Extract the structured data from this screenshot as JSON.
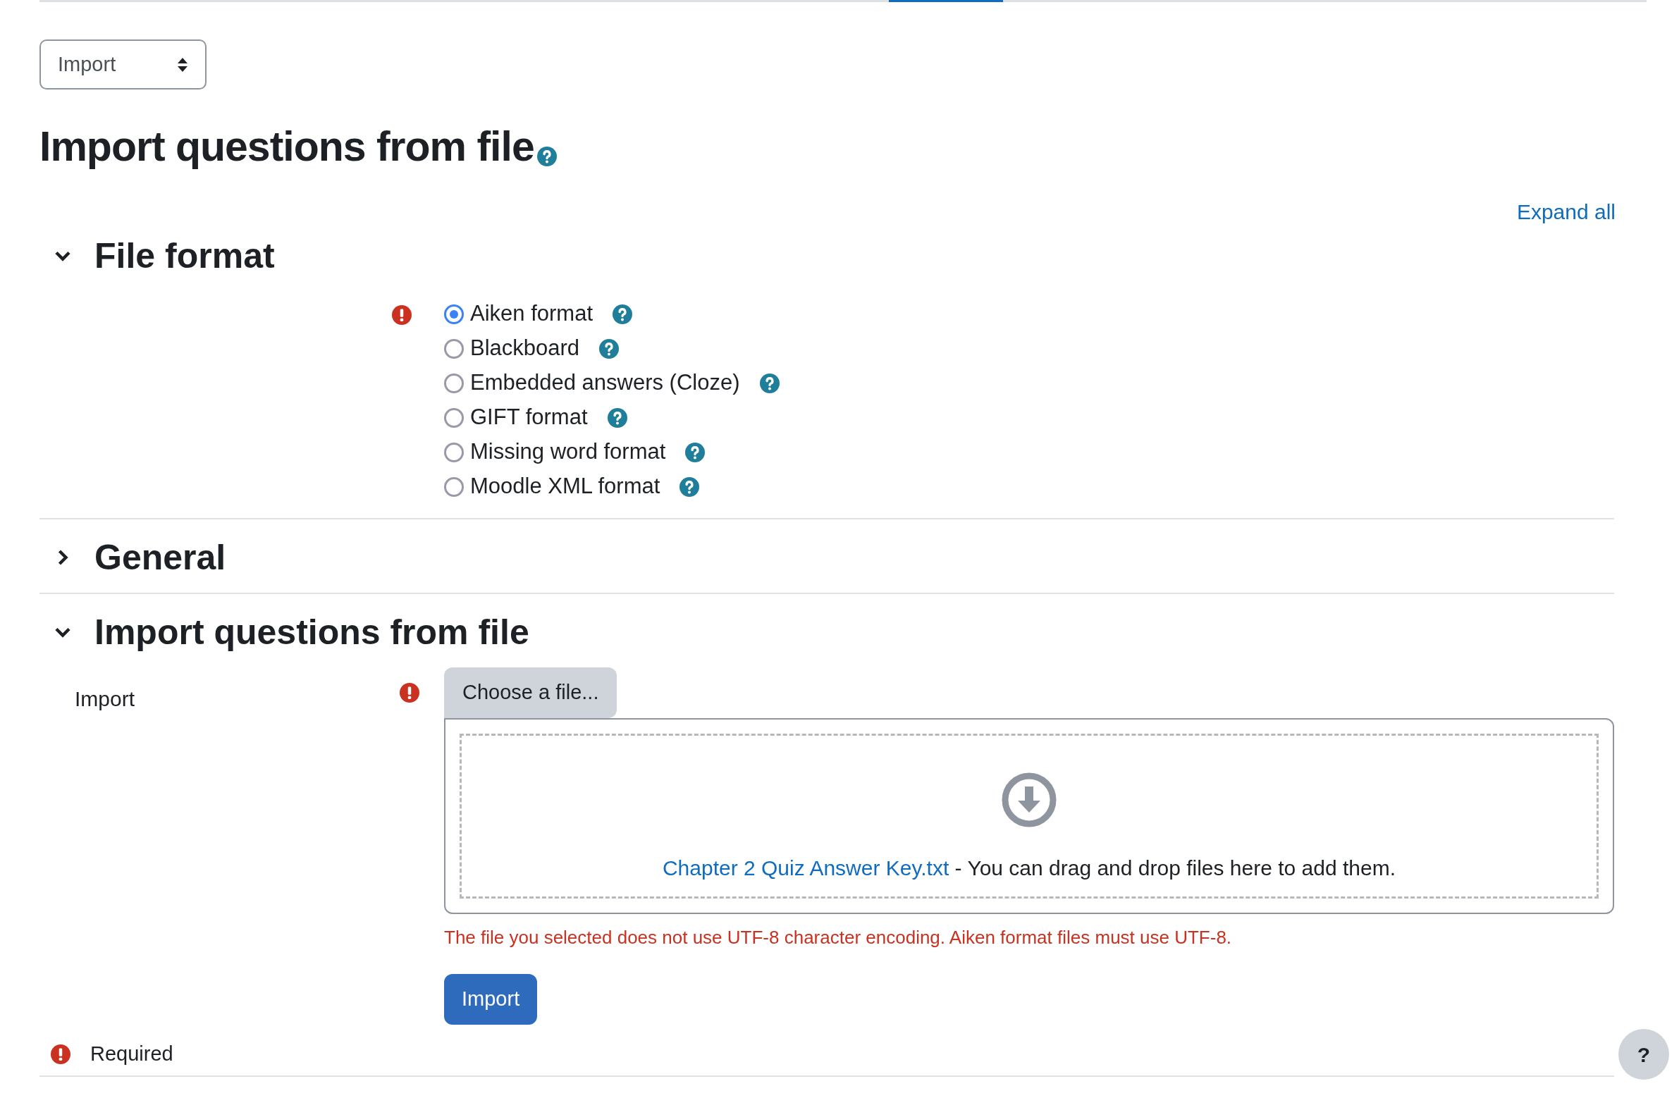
{
  "action_select": {
    "value": "Import"
  },
  "page_title": "Import questions from file",
  "expand_all": "Expand all",
  "sections": [
    {
      "kind": "radio_group",
      "title": "File format",
      "expanded": true,
      "required": true,
      "options": [
        {
          "label": "Aiken format",
          "selected": true
        },
        {
          "label": "Blackboard",
          "selected": false
        },
        {
          "label": "Embedded answers (Cloze)",
          "selected": false
        },
        {
          "label": "GIFT format",
          "selected": false
        },
        {
          "label": "Missing word format",
          "selected": false
        },
        {
          "label": "Moodle XML format",
          "selected": false
        }
      ]
    },
    {
      "kind": "plain",
      "title": "General",
      "expanded": false
    },
    {
      "kind": "file_upload",
      "title": "Import questions from file",
      "expanded": true,
      "field_label": "Import",
      "required": true,
      "choose_button": "Choose a file...",
      "file_link": "Chapter 2 Quiz Answer Key.txt",
      "drop_hint": "- You can drag and drop files here to add them.",
      "error": "The file you selected does not use UTF-8 character encoding. Aiken format files must use UTF-8.",
      "submit": "Import"
    }
  ],
  "required_note": "Required",
  "help_button": "?"
}
